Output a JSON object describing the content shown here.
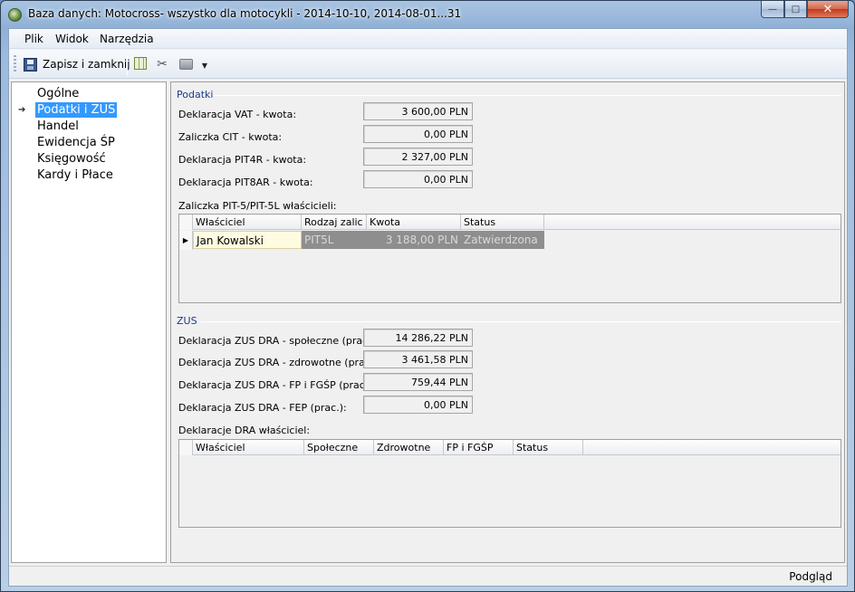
{
  "window": {
    "title": "Baza danych: Motocross- wszystko dla motocykli - 2014-10-10, 2014-08-01...31",
    "controls": {
      "minimize": "—",
      "maximize": "□",
      "close": "✕"
    }
  },
  "menu": [
    {
      "label": "Plik"
    },
    {
      "label": "Widok"
    },
    {
      "label": "Narzędzia"
    }
  ],
  "toolbar": {
    "save_label": "Zapisz i zamknij"
  },
  "nav": {
    "items": [
      {
        "label": "Ogólne"
      },
      {
        "label": "Podatki i ZUS"
      },
      {
        "label": "Handel"
      },
      {
        "label": "Ewidencja ŚP"
      },
      {
        "label": "Księgowość"
      },
      {
        "label": "Kardy i Płace"
      }
    ],
    "selected_index": 1
  },
  "podatki": {
    "title": "Podatki",
    "fields": [
      {
        "label": "Deklaracja VAT - kwota:",
        "value": "3 600,00 PLN"
      },
      {
        "label": "Zaliczka CIT - kwota:",
        "value": "0,00 PLN"
      },
      {
        "label": "Deklaracja PIT4R - kwota:",
        "value": "2 327,00 PLN"
      },
      {
        "label": "Deklaracja PIT8AR - kwota:",
        "value": "0,00 PLN"
      }
    ],
    "owners_label": "Zaliczka PIT-5/PIT-5L właścicieli:",
    "owners_table": {
      "columns": [
        "Właściciel",
        "Rodzaj zalic",
        "Kwota",
        "Status"
      ],
      "rows": [
        {
          "owner": "Jan Kowalski",
          "type": "PIT5L",
          "amount": "3 188,00 PLN",
          "status": "Zatwierdzona"
        }
      ]
    }
  },
  "zus": {
    "title": "ZUS",
    "fields": [
      {
        "label": "Deklaracja ZUS DRA - społeczne (prac.):",
        "value": "14 286,22 PLN"
      },
      {
        "label": "Deklaracja ZUS DRA - zdrowotne (prac.):",
        "value": "3 461,58 PLN"
      },
      {
        "label": "Deklaracja ZUS DRA - FP i FGŚP (prac.)",
        "value": "759,44 PLN"
      },
      {
        "label": "Deklaracja ZUS DRA - FEP (prac.):",
        "value": "0,00 PLN"
      }
    ],
    "dra_label": "Deklaracje DRA właściciel:",
    "dra_table": {
      "columns": [
        "Właściciel",
        "Społeczne",
        "Zdrowotne",
        "FP i FGŚP",
        "Status"
      ]
    }
  },
  "status_bar": {
    "text": "Podgląd"
  }
}
